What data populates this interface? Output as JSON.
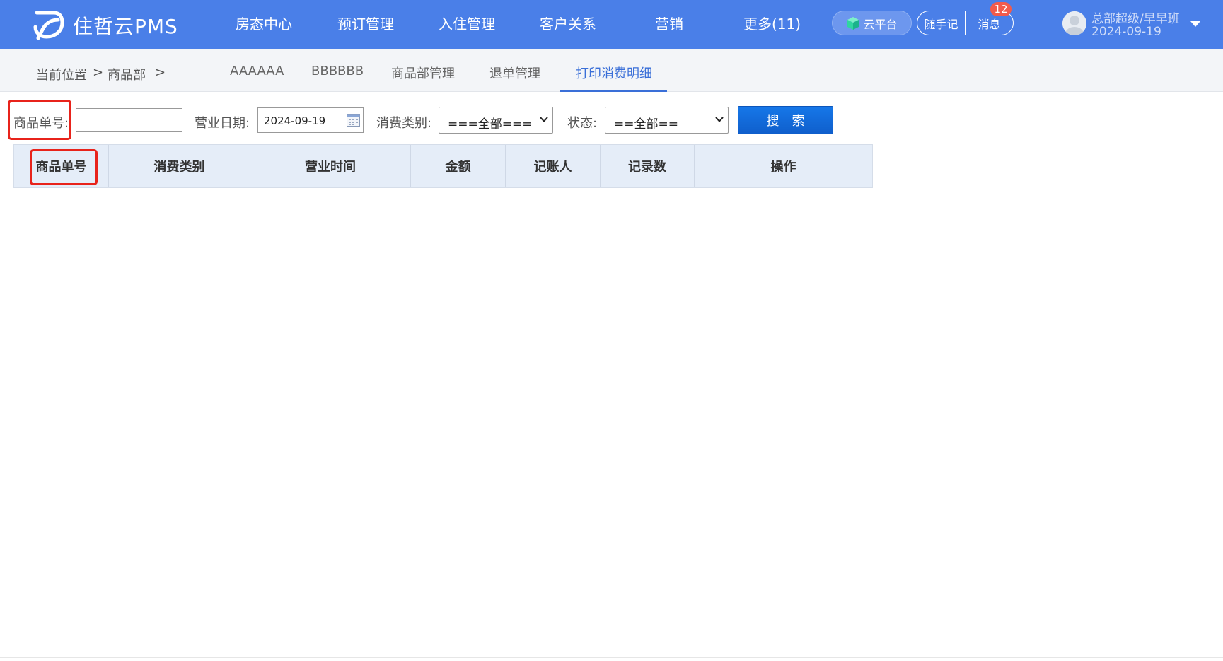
{
  "app": {
    "brand": "住哲云PMS"
  },
  "nav": {
    "items": [
      "房态中心",
      "预订管理",
      "入住管理",
      "客户关系",
      "营销",
      "更多(11)"
    ]
  },
  "header_actions": {
    "cloud_platform": "云平台",
    "notes": "随手记",
    "messages": "消息",
    "message_badge": "12"
  },
  "user": {
    "name": "总部超级/早早班",
    "date": "2024-09-19"
  },
  "breadcrumb": {
    "location": "当前位置",
    "sep": ">",
    "current": "商品部",
    "sep2": ">"
  },
  "tabs": [
    {
      "label": "AAAAAA",
      "active": false
    },
    {
      "label": "BBBBBB",
      "active": false
    },
    {
      "label": "商品部管理",
      "active": false
    },
    {
      "label": "退单管理",
      "active": false
    },
    {
      "label": "打印消费明细",
      "active": true
    }
  ],
  "filters": {
    "order_no_label": "商品单号:",
    "order_no_value": "",
    "date_label": "营业日期:",
    "date_value": "2024-09-19",
    "category_label": "消费类别:",
    "category_value": "===全部===",
    "status_label": "状态:",
    "status_value": "==全部==",
    "search_button": "搜索"
  },
  "table": {
    "columns": [
      "商品单号",
      "消费类别",
      "营业时间",
      "金额",
      "记账人",
      "记录数",
      "操作"
    ]
  },
  "colors": {
    "topbar": "#4a7fe8",
    "accent": "#3a6fd8",
    "search_button": "#1677e8",
    "highlight": "#e8231b",
    "table_header": "#e5edf8"
  }
}
